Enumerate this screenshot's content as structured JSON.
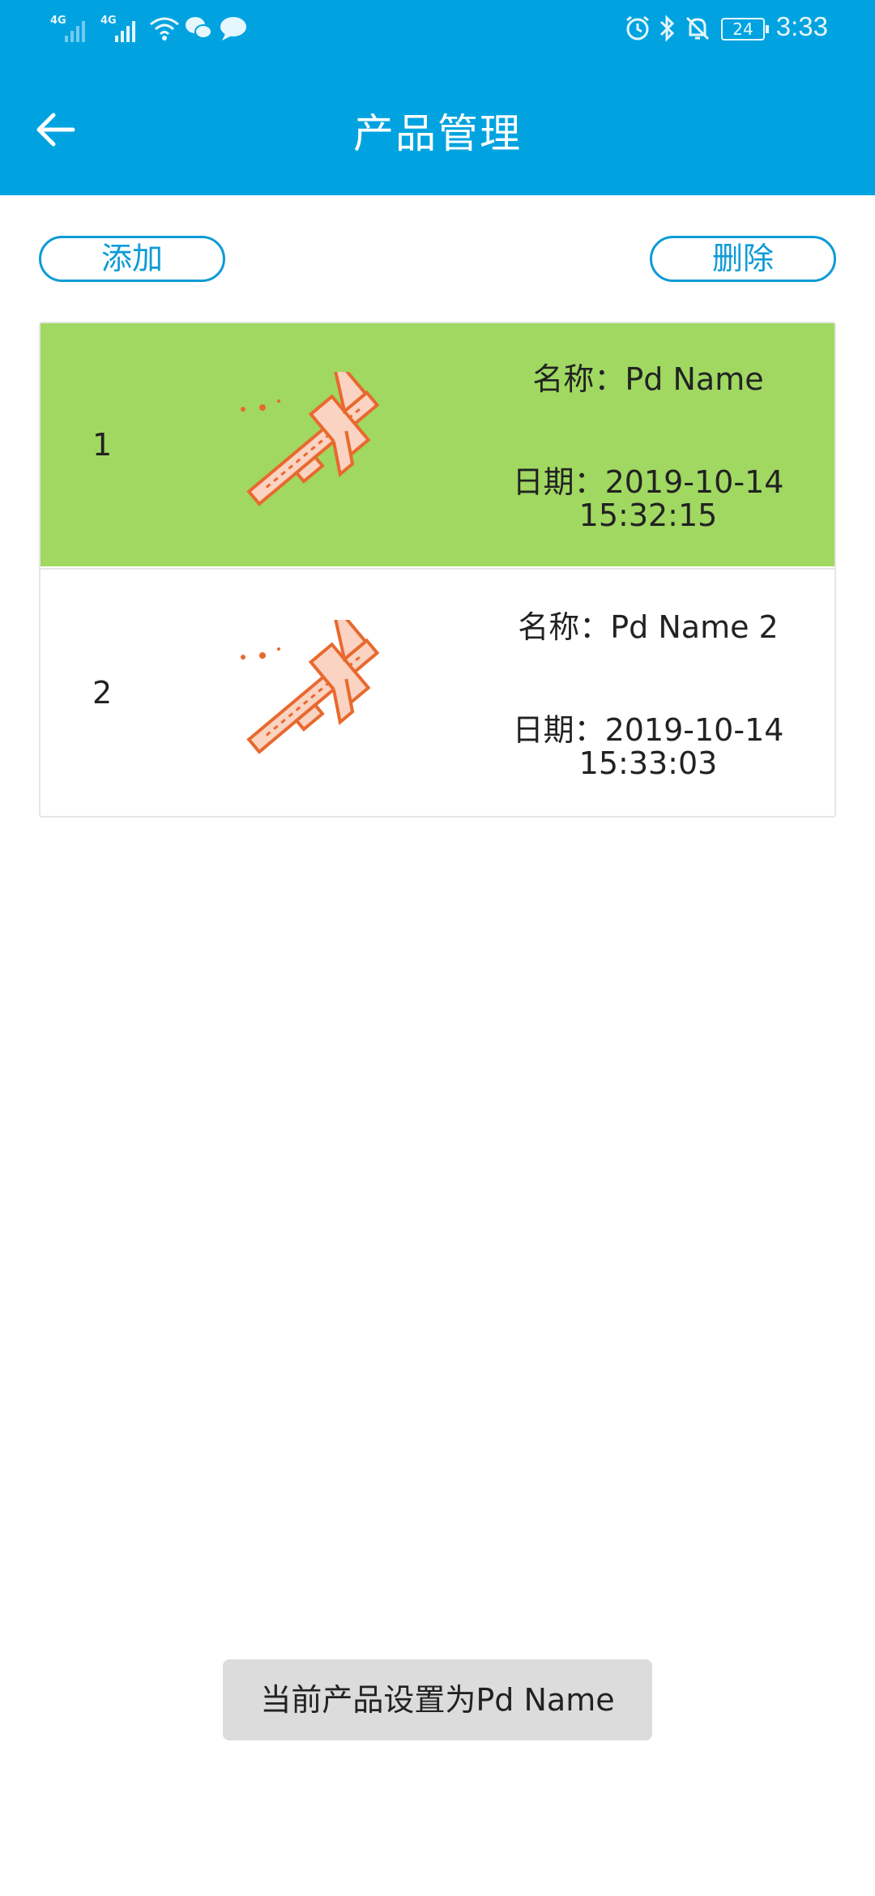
{
  "status_bar": {
    "signal1_tag": "4G",
    "signal2_tag": "4G",
    "battery": "24",
    "time": "3:33",
    "icons": [
      "signal-icon",
      "signal-icon",
      "wifi-icon",
      "wechat-icon",
      "chat-icon",
      "alarm-icon",
      "bluetooth-icon",
      "bell-off-icon",
      "battery-icon"
    ]
  },
  "header": {
    "title": "产品管理",
    "back_icon": "arrow-left-icon",
    "background": "#00a3e0"
  },
  "actions": {
    "add_label": "添加",
    "delete_label": "删除",
    "accent": "#0d9bd6"
  },
  "products": [
    {
      "index": "1",
      "name": "名称：Pd Name",
      "date_line1": "日期：2019-10-14",
      "date_line2": "15:32:15",
      "selected": true,
      "icon": "caliper-icon"
    },
    {
      "index": "2",
      "name": "名称：Pd Name 2",
      "date_line1": "日期：2019-10-14",
      "date_line2": "15:33:03",
      "selected": false,
      "icon": "caliper-icon"
    }
  ],
  "selected_color": "#a0d861",
  "toast": {
    "text": "当前产品设置为Pd Name"
  }
}
